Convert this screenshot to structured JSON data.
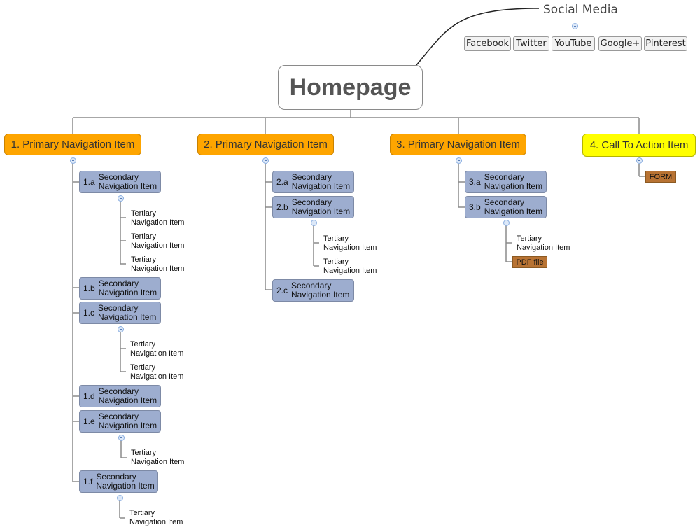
{
  "root": {
    "label": "Homepage"
  },
  "social": {
    "title": "Social Media",
    "items": [
      "Facebook",
      "Twitter",
      "YouTube",
      "Google+",
      "Pinterest"
    ]
  },
  "primary": [
    {
      "label": "1. Primary Navigation Item",
      "children": [
        {
          "num": "1.a",
          "label": "Secondary Navigation Item",
          "children": [
            "Tertiary Navigation Item",
            "Tertiary Navigation Item",
            "Tertiary Navigation Item"
          ]
        },
        {
          "num": "1.b",
          "label": "Secondary Navigation Item",
          "children": []
        },
        {
          "num": "1.c",
          "label": "Secondary Navigation Item",
          "children": [
            "Tertiary Navigation Item",
            "Tertiary Navigation Item"
          ]
        },
        {
          "num": "1.d",
          "label": "Secondary Navigation Item",
          "children": []
        },
        {
          "num": "1.e",
          "label": "Secondary Navigation Item",
          "children": [
            "Tertiary Navigation Item"
          ]
        },
        {
          "num": "1.f",
          "label": "Secondary Navigation Item",
          "children": [
            "Tertiary Navigation Item"
          ]
        }
      ]
    },
    {
      "label": "2. Primary Navigation Item",
      "children": [
        {
          "num": "2.a",
          "label": "Secondary Navigation Item",
          "children": []
        },
        {
          "num": "2.b",
          "label": "Secondary Navigation Item",
          "children": [
            "Tertiary Navigation Item",
            "Tertiary Navigation Item"
          ]
        },
        {
          "num": "2.c",
          "label": "Secondary Navigation Item",
          "children": []
        }
      ]
    },
    {
      "label": "3. Primary Navigation Item",
      "children": [
        {
          "num": "3.a",
          "label": "Secondary Navigation Item",
          "children": []
        },
        {
          "num": "3.b",
          "label": "Secondary Navigation Item",
          "children": [
            "Tertiary Navigation Item"
          ],
          "tag": "PDF file"
        }
      ]
    },
    {
      "label": "4. Call To Action Item",
      "tag": "FORM"
    }
  ],
  "colors": {
    "primary": "#fea500",
    "cta": "#ffff00",
    "secondary": "#9dadcf",
    "tag": "#b87333",
    "connector": "#8a8a8a"
  }
}
